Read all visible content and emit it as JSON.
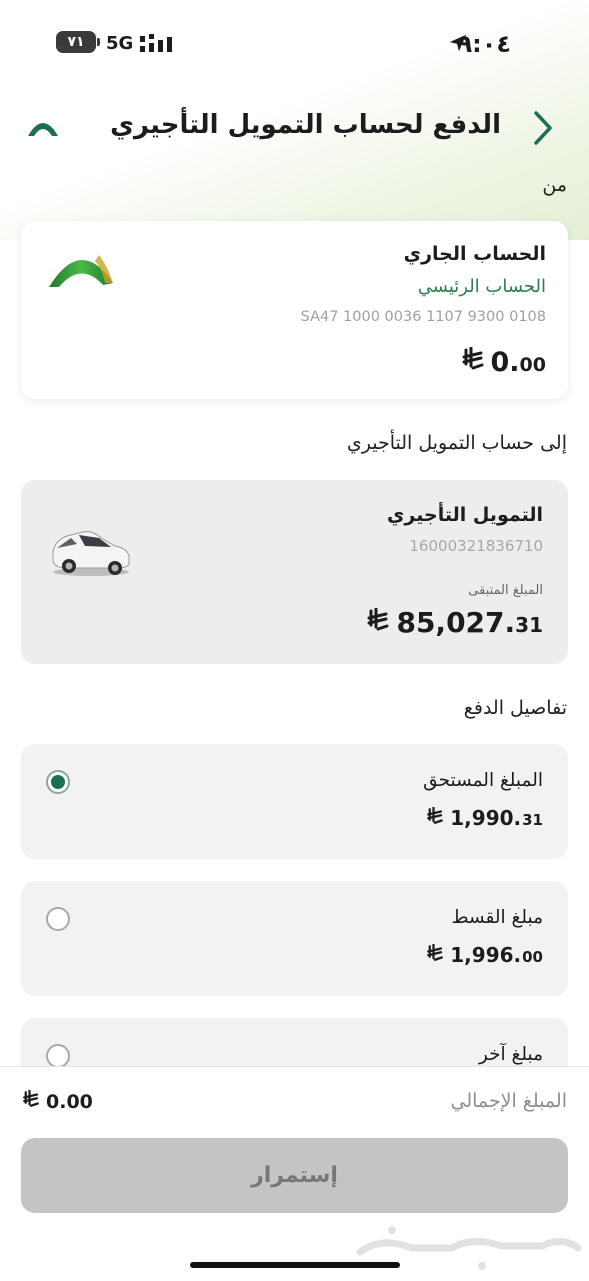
{
  "status_bar": {
    "time": "٩:٠٤",
    "network": "5G",
    "battery": "٧١"
  },
  "header": {
    "title": "الدفع لحساب التمويل التأجيري"
  },
  "from": {
    "label": "من",
    "account_name": "الحساب الجاري",
    "account_type": "الحساب الرئيسي",
    "iban": "SA47 1000 0036 1107 9300 0108",
    "balance_int": "0.",
    "balance_dec": "00"
  },
  "to": {
    "label": "إلى حساب التمويل التأجيري",
    "name": "التمويل التأجيري",
    "number": "16000321836710",
    "remaining_label": "المبلغ المتبقى",
    "remaining_int": "85,027.",
    "remaining_dec": "31"
  },
  "details": {
    "label": "تفاصيل الدفع",
    "options": [
      {
        "label": "المبلغ المستحق",
        "amount_int": "1,990.",
        "amount_dec": "31",
        "selected": true
      },
      {
        "label": "مبلغ القسط",
        "amount_int": "1,996.",
        "amount_dec": "00",
        "selected": false
      },
      {
        "label": "مبلغ آخر",
        "selected": false
      }
    ]
  },
  "footer": {
    "total_label": "المبلغ الإجمالي",
    "total": "0.00",
    "continue_label": "إستمرار"
  },
  "colors": {
    "brand_green": "#1b6f55",
    "accent_green": "#2e8b3c",
    "disabled": "#c4c4c4"
  }
}
